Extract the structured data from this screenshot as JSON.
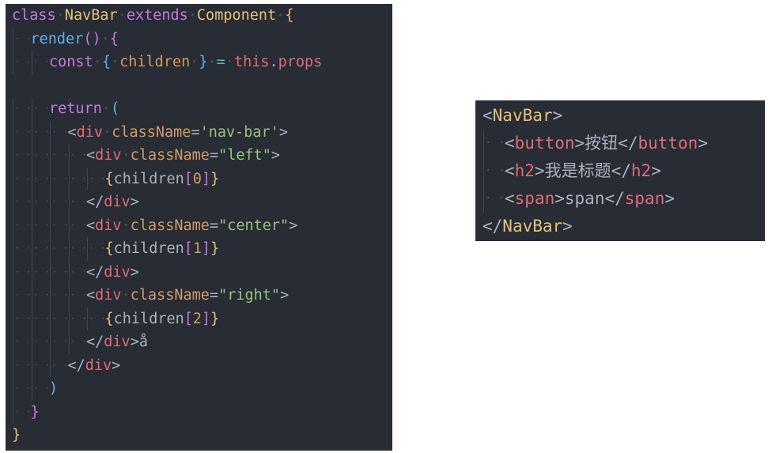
{
  "editor_left": {
    "lines": [
      {
        "indent": 0,
        "tokens": [
          {
            "t": "class",
            "c": "kw"
          },
          {
            "t": " ",
            "c": "ws"
          },
          {
            "t": "NavBar",
            "c": "cls"
          },
          {
            "t": " ",
            "c": "ws"
          },
          {
            "t": "extends",
            "c": "kw"
          },
          {
            "t": " ",
            "c": "ws"
          },
          {
            "t": "Component",
            "c": "cls"
          },
          {
            "t": " ",
            "c": "ws"
          },
          {
            "t": "{",
            "c": "b1"
          }
        ]
      },
      {
        "indent": 1,
        "tokens": [
          {
            "t": "render",
            "c": "fn"
          },
          {
            "t": "()",
            "c": "b2"
          },
          {
            "t": " ",
            "c": "ws"
          },
          {
            "t": "{",
            "c": "b2"
          }
        ]
      },
      {
        "indent": 2,
        "tokens": [
          {
            "t": "const",
            "c": "kw"
          },
          {
            "t": " ",
            "c": "ws"
          },
          {
            "t": "{",
            "c": "b3"
          },
          {
            "t": " ",
            "c": "ws"
          },
          {
            "t": "children",
            "c": "var"
          },
          {
            "t": " ",
            "c": "ws"
          },
          {
            "t": "}",
            "c": "b3"
          },
          {
            "t": " ",
            "c": "ws"
          },
          {
            "t": "=",
            "c": "op"
          },
          {
            "t": " ",
            "c": "ws"
          },
          {
            "t": "this",
            "c": "thisc"
          },
          {
            "t": ".",
            "c": "pun"
          },
          {
            "t": "props",
            "c": "prop"
          }
        ]
      },
      {
        "indent": 0,
        "tokens": []
      },
      {
        "indent": 2,
        "tokens": [
          {
            "t": "return",
            "c": "kw"
          },
          {
            "t": " ",
            "c": "ws"
          },
          {
            "t": "(",
            "c": "b3"
          }
        ]
      },
      {
        "indent": 3,
        "tokens": [
          {
            "t": "<",
            "c": "pun"
          },
          {
            "t": "div",
            "c": "tag"
          },
          {
            "t": " ",
            "c": "ws"
          },
          {
            "t": "className",
            "c": "attr"
          },
          {
            "t": "=",
            "c": "pun"
          },
          {
            "t": "'nav-bar'",
            "c": "str"
          },
          {
            "t": ">",
            "c": "pun"
          }
        ]
      },
      {
        "indent": 4,
        "tokens": [
          {
            "t": "<",
            "c": "pun"
          },
          {
            "t": "div",
            "c": "tag"
          },
          {
            "t": " ",
            "c": "ws"
          },
          {
            "t": "className",
            "c": "attr"
          },
          {
            "t": "=",
            "c": "pun"
          },
          {
            "t": "\"left\"",
            "c": "str"
          },
          {
            "t": ">",
            "c": "pun"
          }
        ]
      },
      {
        "indent": 5,
        "tokens": [
          {
            "t": "{",
            "c": "b1"
          },
          {
            "t": "children",
            "c": "txt"
          },
          {
            "t": "[",
            "c": "b2"
          },
          {
            "t": "0",
            "c": "num"
          },
          {
            "t": "]",
            "c": "b2"
          },
          {
            "t": "}",
            "c": "b1"
          }
        ]
      },
      {
        "indent": 4,
        "tokens": [
          {
            "t": "</",
            "c": "pun"
          },
          {
            "t": "div",
            "c": "tag"
          },
          {
            "t": ">",
            "c": "pun"
          }
        ]
      },
      {
        "indent": 4,
        "tokens": [
          {
            "t": "<",
            "c": "pun"
          },
          {
            "t": "div",
            "c": "tag"
          },
          {
            "t": " ",
            "c": "ws"
          },
          {
            "t": "className",
            "c": "attr"
          },
          {
            "t": "=",
            "c": "pun"
          },
          {
            "t": "\"center\"",
            "c": "str"
          },
          {
            "t": ">",
            "c": "pun"
          }
        ]
      },
      {
        "indent": 5,
        "tokens": [
          {
            "t": "{",
            "c": "b1"
          },
          {
            "t": "children",
            "c": "txt"
          },
          {
            "t": "[",
            "c": "b2"
          },
          {
            "t": "1",
            "c": "num"
          },
          {
            "t": "]",
            "c": "b2"
          },
          {
            "t": "}",
            "c": "b1"
          }
        ]
      },
      {
        "indent": 4,
        "tokens": [
          {
            "t": "</",
            "c": "pun"
          },
          {
            "t": "div",
            "c": "tag"
          },
          {
            "t": ">",
            "c": "pun"
          }
        ]
      },
      {
        "indent": 4,
        "tokens": [
          {
            "t": "<",
            "c": "pun"
          },
          {
            "t": "div",
            "c": "tag"
          },
          {
            "t": " ",
            "c": "ws"
          },
          {
            "t": "className",
            "c": "attr"
          },
          {
            "t": "=",
            "c": "pun"
          },
          {
            "t": "\"right\"",
            "c": "str"
          },
          {
            "t": ">",
            "c": "pun"
          }
        ]
      },
      {
        "indent": 5,
        "tokens": [
          {
            "t": "{",
            "c": "b1"
          },
          {
            "t": "children",
            "c": "txt"
          },
          {
            "t": "[",
            "c": "b2"
          },
          {
            "t": "2",
            "c": "num"
          },
          {
            "t": "]",
            "c": "b2"
          },
          {
            "t": "}",
            "c": "b1"
          }
        ]
      },
      {
        "indent": 4,
        "tokens": [
          {
            "t": "</",
            "c": "pun"
          },
          {
            "t": "div",
            "c": "tag"
          },
          {
            "t": ">",
            "c": "pun"
          },
          {
            "t": "å",
            "c": "txt"
          }
        ]
      },
      {
        "indent": 3,
        "tokens": [
          {
            "t": "</",
            "c": "pun"
          },
          {
            "t": "div",
            "c": "tag"
          },
          {
            "t": ">",
            "c": "pun"
          }
        ]
      },
      {
        "indent": 2,
        "tokens": [
          {
            "t": ")",
            "c": "b3"
          }
        ]
      },
      {
        "indent": 1,
        "tokens": [
          {
            "t": "}",
            "c": "b2"
          }
        ]
      },
      {
        "indent": 0,
        "tokens": [
          {
            "t": "}",
            "c": "b1"
          }
        ]
      }
    ]
  },
  "editor_right": {
    "lines": [
      {
        "indent": 0,
        "tokens": [
          {
            "t": "<",
            "c": "pun"
          },
          {
            "t": "NavBar",
            "c": "cls"
          },
          {
            "t": ">",
            "c": "pun"
          }
        ]
      },
      {
        "indent": 1,
        "tokens": [
          {
            "t": "<",
            "c": "pun"
          },
          {
            "t": "button",
            "c": "tag"
          },
          {
            "t": ">",
            "c": "pun"
          },
          {
            "t": "按钮",
            "c": "txt"
          },
          {
            "t": "</",
            "c": "pun"
          },
          {
            "t": "button",
            "c": "tag"
          },
          {
            "t": ">",
            "c": "pun"
          }
        ]
      },
      {
        "indent": 1,
        "tokens": [
          {
            "t": "<",
            "c": "pun"
          },
          {
            "t": "h2",
            "c": "tag"
          },
          {
            "t": ">",
            "c": "pun"
          },
          {
            "t": "我是标题",
            "c": "txt"
          },
          {
            "t": "</",
            "c": "pun"
          },
          {
            "t": "h2",
            "c": "tag"
          },
          {
            "t": ">",
            "c": "pun"
          }
        ]
      },
      {
        "indent": 1,
        "tokens": [
          {
            "t": "<",
            "c": "pun"
          },
          {
            "t": "span",
            "c": "tag"
          },
          {
            "t": ">",
            "c": "pun"
          },
          {
            "t": "span",
            "c": "txt"
          },
          {
            "t": "</",
            "c": "pun"
          },
          {
            "t": "span",
            "c": "tag"
          },
          {
            "t": ">",
            "c": "pun"
          }
        ]
      },
      {
        "indent": 0,
        "tokens": [
          {
            "t": "</",
            "c": "pun"
          },
          {
            "t": "NavBar",
            "c": "cls"
          },
          {
            "t": ">",
            "c": "pun"
          }
        ]
      }
    ]
  }
}
